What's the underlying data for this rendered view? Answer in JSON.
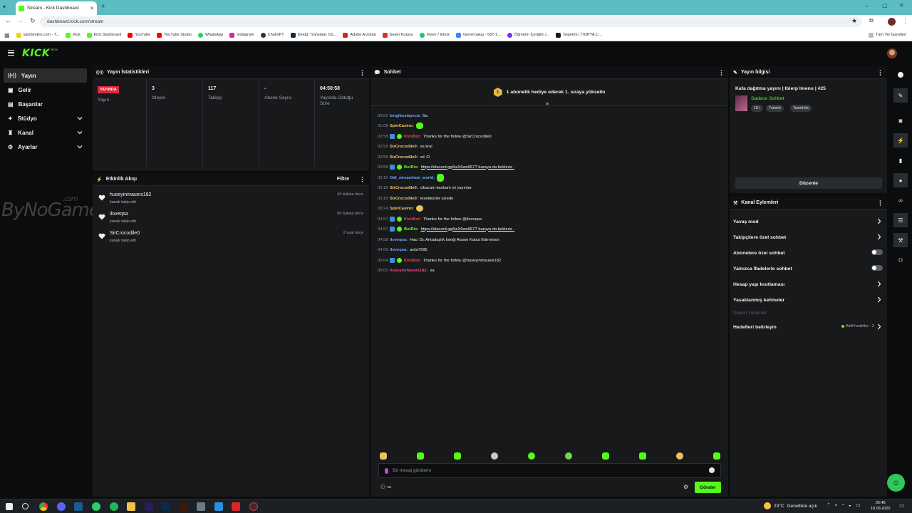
{
  "browser": {
    "tab_title": "Stream - Kick Dashboard",
    "url": "dashboard.kick.com/stream",
    "bookmarks": [
      "sahibinden.com - T...",
      "Kick",
      "Kick Dashboard",
      "YouTube",
      "YouTube Studio",
      "WhatsApp",
      "Instagram",
      "ChatGPT",
      "DeepL Translate: Dü...",
      "Adobe Acrobat",
      "Gelen Kutusu",
      "Fiverr / Inbox",
      "Genel bakış - 567-1...",
      "Öğrenim İçeriğim |...",
      "Sepetim | İTOPYA.C..."
    ],
    "all_bookmarks": "Tüm Yer İşaretleri"
  },
  "app": {
    "logo": "KICK",
    "beta": "BETA"
  },
  "sidebar": {
    "items": [
      {
        "label": "Yayın"
      },
      {
        "label": "Gelir"
      },
      {
        "label": "Başarılar"
      },
      {
        "label": "Stüdyo"
      },
      {
        "label": "Kanal"
      },
      {
        "label": "Ayarlar"
      }
    ]
  },
  "stats": {
    "title": "Yayın İstatistikleri",
    "items": [
      {
        "value": "YAYINDA",
        "label": "Yayın"
      },
      {
        "value": "3",
        "label": "İzleyici"
      },
      {
        "value": "117",
        "label": "Takipçi"
      },
      {
        "value": "-",
        "label": "Abone Sayısı"
      },
      {
        "value": "04:50:58",
        "label": "Yayında Olduğu Süre"
      }
    ]
  },
  "activity": {
    "title": "Etkinlik Akışı",
    "filter": "Filtre",
    "events": [
      {
        "name": "huseyinmaueis182",
        "sub": "kanalı takip etti",
        "time": "43 dakika önce"
      },
      {
        "name": "iloveqsa",
        "sub": "kanalı takip etti",
        "time": "50 dakika önce"
      },
      {
        "name": "SirCrocodile0",
        "sub": "kanalı takip etti",
        "time": "2 saat önce"
      }
    ]
  },
  "watermark": {
    "text": "ByNoGame",
    "suffix": ".com"
  },
  "chat": {
    "title": "Sohbet",
    "banner": "1 abonelik hediye ederek 1. sıraya yükselin",
    "banner_badge": "1",
    "messages": [
      {
        "time": "00:51",
        "user": "kingIbesiayecis",
        "color": "#6fa8ff",
        "text": "Sa"
      },
      {
        "time": "01:08",
        "user": "SpinCasino:",
        "color": "#f3c96a",
        "text": ""
      },
      {
        "time": "02:58",
        "user": "KickBot:",
        "color": "#e84b4b",
        "text": "Thanks for the follow @SirCrocodile0"
      },
      {
        "time": "02:58",
        "user": "SirCrocodile0:",
        "color": "#f3c96a",
        "text": "sa kral"
      },
      {
        "time": "02:58",
        "user": "SirCrocodile0:",
        "color": "#f3c96a",
        "text": "xd :D"
      },
      {
        "time": "02:58",
        "user": "BotRix:",
        "color": "#53fc18",
        "text": "https://discord.gg/bsX6ws967T buraya da bekleriz ."
      },
      {
        "time": "03:16",
        "user": "Odi_streamhub_world:",
        "color": "#6fa8ff",
        "text": ""
      },
      {
        "time": "03:18",
        "user": "SirCrocodile0:",
        "color": "#f3c96a",
        "text": "cikacam kankam iyi yayınlar"
      },
      {
        "time": "03:18",
        "user": "SirCrocodile0:",
        "color": "#f3c96a",
        "text": "tesekkürler sizede"
      },
      {
        "time": "03:24",
        "user": "SpinCasino:",
        "color": "#f3c96a",
        "text": ""
      },
      {
        "time": "04:57",
        "user": "KickBot:",
        "color": "#e84b4b",
        "text": "Thanks for the follow @iloveqsa"
      },
      {
        "time": "04:57",
        "user": "BotRix:",
        "color": "#53fc18",
        "text": "https://discord.gg/bsX6ws967T buraya da bekleriz ."
      },
      {
        "time": "04:58",
        "user": "iloveqsa:",
        "color": "#6fa8ff",
        "text": "Hacı Dc Arkadaşlık İsteği Atsam Kabul Edermisin"
      },
      {
        "time": "04:59",
        "user": "iloveqsa:",
        "color": "#6fa8ff",
        "text": "arda7995"
      },
      {
        "time": "05:04",
        "user": "KickBot:",
        "color": "#e84b4b",
        "text": "Thanks for the follow @huseyinmaueis182"
      },
      {
        "time": "05:05",
        "user": "huseyinmaueis182:",
        "color": "#e84b87",
        "text": "sa"
      }
    ],
    "input_placeholder": "Bir mesaj gönderin",
    "send": "Gönder"
  },
  "stream_info": {
    "title": "Yayın bilgisi",
    "stream_title": "Kafa dağıtma yayını | Ibierp Imenu | #25",
    "category": "Sadece Sohbet",
    "tags": [
      "18+",
      "Turkish",
      "TeamHds"
    ],
    "edit": "Düzenle"
  },
  "channel_actions": {
    "title": "Kanal Eylemleri",
    "items": [
      {
        "label": "Yavaş mod",
        "kind": "arrow"
      },
      {
        "label": "Takipçilere özel sohbet",
        "kind": "arrow"
      },
      {
        "label": "Abonelere özel sohbet",
        "kind": "toggle"
      },
      {
        "label": "Yalnızca İfadelerle sohbet",
        "kind": "toggle"
      },
      {
        "label": "Hesap yaşı kısıtlaması",
        "kind": "arrow"
      },
      {
        "label": "Yasaklanmış kelimeler",
        "kind": "arrow"
      }
    ],
    "section": "İzleyici Yönlendir",
    "goals_label": "Hedefleri belirleyin",
    "goals_status": "Aktif hedefler - 2"
  },
  "taskbar": {
    "weather": "23°C",
    "weather_desc": "Genellikle açık",
    "time": "05:48",
    "date": "18.08.2025"
  },
  "colors": {
    "accent": "#53fc18",
    "live": "#e4243b",
    "bg": "#0b0c0d",
    "panel": "#18191b"
  }
}
